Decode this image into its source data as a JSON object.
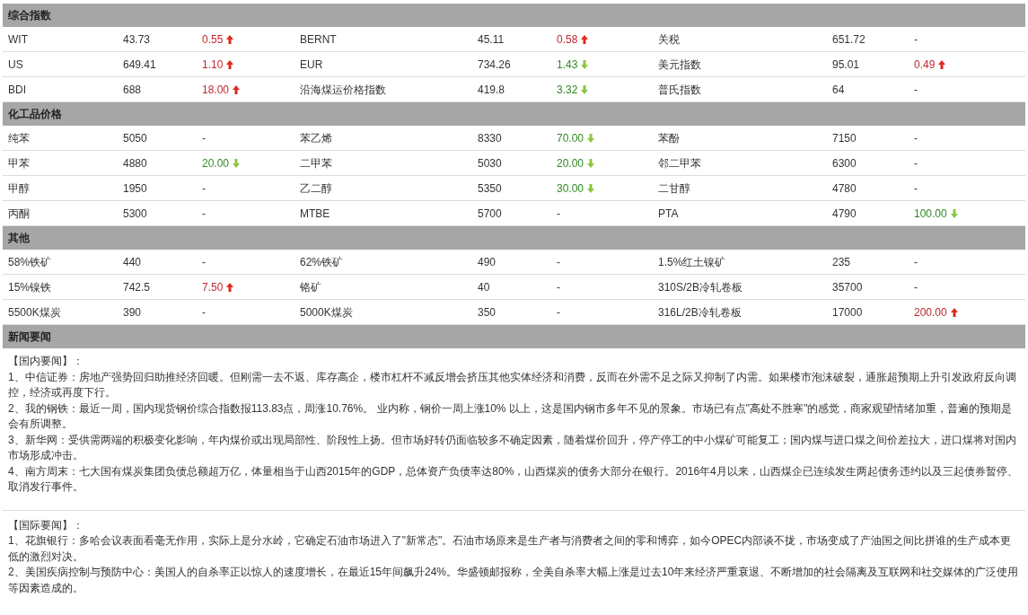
{
  "sections": [
    {
      "title": "综合指数",
      "rows": [
        [
          {
            "name": "WIT",
            "value": "43.73",
            "change": "0.55",
            "rising": true
          },
          {
            "name": "BERNT",
            "value": "45.11",
            "change": "0.58",
            "rising": true
          },
          {
            "name": "关税",
            "value": "651.72",
            "change": "-"
          }
        ],
        [
          {
            "name": "US",
            "value": "649.41",
            "change": "1.10",
            "rising": true
          },
          {
            "name": "EUR",
            "value": "734.26",
            "change": "1.43",
            "rising": false
          },
          {
            "name": "美元指数",
            "value": "95.01",
            "change": "0.49",
            "rising": true
          }
        ],
        [
          {
            "name": "BDI",
            "value": "688",
            "change": "18.00",
            "rising": true
          },
          {
            "name": "沿海煤运价格指数",
            "value": "419.8",
            "change": "3.32",
            "rising": false
          },
          {
            "name": "普氏指数",
            "value": "64",
            "change": "-"
          }
        ]
      ]
    },
    {
      "title": "化工品价格",
      "rows": [
        [
          {
            "name": "纯苯",
            "value": "5050",
            "change": "-"
          },
          {
            "name": "苯乙烯",
            "value": "8330",
            "change": "70.00",
            "rising": false
          },
          {
            "name": "苯酚",
            "value": "7150",
            "change": "-"
          }
        ],
        [
          {
            "name": "甲苯",
            "value": "4880",
            "change": "20.00",
            "rising": false
          },
          {
            "name": "二甲苯",
            "value": "5030",
            "change": "20.00",
            "rising": false
          },
          {
            "name": "邻二甲苯",
            "value": "6300",
            "change": "-"
          }
        ],
        [
          {
            "name": "甲醇",
            "value": "1950",
            "change": "-"
          },
          {
            "name": "乙二醇",
            "value": "5350",
            "change": "30.00",
            "rising": false
          },
          {
            "name": "二甘醇",
            "value": "4780",
            "change": "-"
          }
        ],
        [
          {
            "name": "丙酮",
            "value": "5300",
            "change": "-"
          },
          {
            "name": "MTBE",
            "value": "5700",
            "change": "-"
          },
          {
            "name": "PTA",
            "value": "4790",
            "change": "100.00",
            "rising": false
          }
        ]
      ]
    },
    {
      "title": "其他",
      "rows": [
        [
          {
            "name": "58%铁矿",
            "value": "440",
            "change": "-"
          },
          {
            "name": "62%铁矿",
            "value": "490",
            "change": "-"
          },
          {
            "name": "1.5%红土镍矿",
            "value": "235",
            "change": "-"
          }
        ],
        [
          {
            "name": "15%镍铁",
            "value": "742.5",
            "change": "7.50",
            "rising": true
          },
          {
            "name": "铬矿",
            "value": "40",
            "change": "-"
          },
          {
            "name": "310S/2B冷轧卷板",
            "value": "35700",
            "change": "-"
          }
        ],
        [
          {
            "name": "5500K煤炭",
            "value": "390",
            "change": "-"
          },
          {
            "name": "5000K煤炭",
            "value": "350",
            "change": "-"
          },
          {
            "name": "316L/2B冷轧卷板",
            "value": "17000",
            "change": "200.00",
            "rising": true
          }
        ]
      ]
    }
  ],
  "news": {
    "title": "新闻要闻",
    "groups": [
      {
        "heading": "【国内要闻】：",
        "items": [
          "1、中信证券：房地产强势回归助推经济回暖。但刚需一去不返、库存高企，楼市杠杆不减反增会挤压其他实体经济和消费，反而在外需不足之际又抑制了内需。如果楼市泡沫破裂，通胀超预期上升引发政府反向调控，经济或再度下行。",
          "2、我的钢铁：最近一周，国内现货钢价综合指数报113.83点，周涨10.76%。 业内称，钢价一周上涨10% 以上，这是国内钢市多年不见的景象。市场已有点\"高处不胜寒\"的感觉，商家观望情绪加重，普遍的预期是会有所调整。",
          "3、新华网：受供需两端的积极变化影响，年内煤价或出现局部性、阶段性上扬。但市场好转仍面临较多不确定因素，随着煤价回升，停产停工的中小煤矿可能复工；国内煤与进口煤之间价差拉大，进口煤将对国内市场形成冲击。",
          "4、南方周末：七大国有煤炭集团负债总额超万亿，体量相当于山西2015年的GDP，总体资产负债率达80%，山西煤炭的债务大部分在银行。2016年4月以来，山西煤企已连续发生两起债务违约以及三起债券暂停、取消发行事件。"
        ]
      },
      {
        "heading": "【国际要闻】：",
        "items": [
          "1、花旗银行：多哈会议表面看毫无作用，实际上是分水岭，它确定石油市场进入了\"新常态\"。石油市场原来是生产者与消费者之间的零和博弈，如今OPEC内部谈不拢，市场变成了产油国之间比拼谁的生产成本更低的激烈对决。",
          "2、美国疾病控制与预防中心：美国人的自杀率正以惊人的速度增长，在最近15年间飙升24%。华盛顿邮报称，全美自杀率大幅上涨是过去10年来经济严重衰退、不断增加的社会隔离及互联网和社交媒体的广泛使用等因素造成的。"
        ]
      }
    ]
  }
}
